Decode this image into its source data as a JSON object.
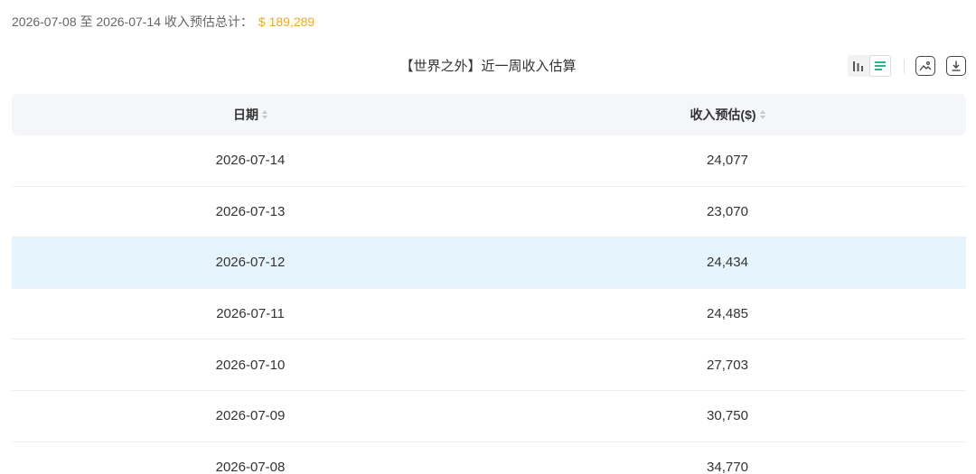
{
  "summary": {
    "range_text": "2026-07-08 至 2026-07-14 收入预估总计：",
    "total": "$ 189,289"
  },
  "chart_title": "【世界之外】近一周收入估算",
  "toolbar": {
    "view_modes": [
      "bar-chart-icon",
      "table-view-icon"
    ],
    "active_view": "table-view-icon",
    "actions": [
      "image-export-icon",
      "download-icon"
    ]
  },
  "table": {
    "columns": [
      "日期",
      "收入预估($)"
    ],
    "rows": [
      {
        "date": "2026-07-14",
        "revenue": "24,077"
      },
      {
        "date": "2026-07-13",
        "revenue": "23,070"
      },
      {
        "date": "2026-07-12",
        "revenue": "24,434"
      },
      {
        "date": "2026-07-11",
        "revenue": "24,485"
      },
      {
        "date": "2026-07-10",
        "revenue": "27,703"
      },
      {
        "date": "2026-07-09",
        "revenue": "30,750"
      },
      {
        "date": "2026-07-08",
        "revenue": "34,770"
      }
    ],
    "highlighted_row": 2
  },
  "colors": {
    "accent_total": "#f5a623",
    "header_bg": "#f4f6f9",
    "row_highlight": "#e6f4fd",
    "toggle_active": "#2bb58c"
  }
}
